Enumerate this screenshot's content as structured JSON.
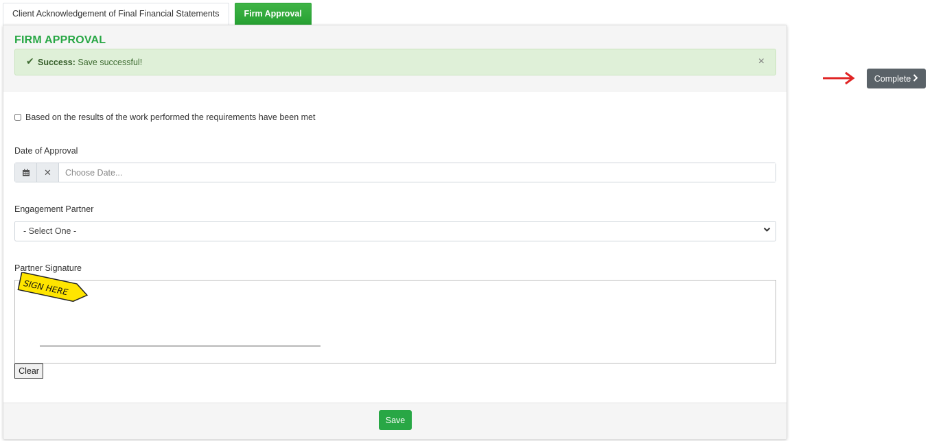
{
  "tabs": [
    {
      "label": "Client Acknowledgement of Final Financial Statements",
      "active": false
    },
    {
      "label": "Firm Approval",
      "active": true
    }
  ],
  "panel": {
    "title": "FIRM APPROVAL",
    "alert": {
      "icon": "check-icon",
      "strong": "Success:",
      "message": "Save successful!",
      "close": "×"
    },
    "checkbox": {
      "label": "Based on the results of the work performed the requirements have been met",
      "checked": false
    },
    "date_field": {
      "label": "Date of Approval",
      "placeholder": "Choose Date...",
      "value": "",
      "calendar_icon": "calendar-icon",
      "clear_icon": "clear-x-icon"
    },
    "partner_field": {
      "label": "Engagement Partner",
      "selected": "- Select One -"
    },
    "signature": {
      "label": "Partner Signature",
      "sticker_text": "SIGN HERE",
      "clear_label": "Clear"
    },
    "footer": {
      "save_label": "Save"
    }
  },
  "side": {
    "complete_label": "Complete",
    "arrow_color": "#e02424"
  },
  "colors": {
    "accent_green": "#28a745",
    "alert_bg": "#dff0d8",
    "complete_bg": "#5a6268",
    "sticker_yellow": "#ffe500"
  }
}
